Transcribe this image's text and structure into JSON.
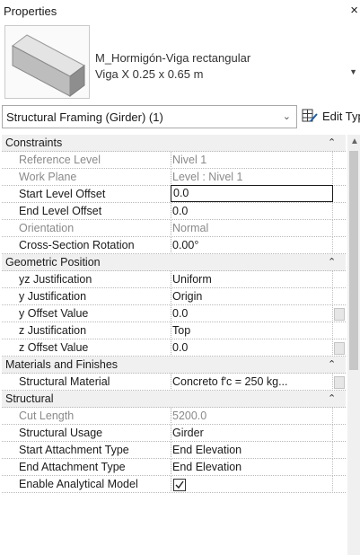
{
  "panel": {
    "title": "Properties",
    "close_glyph": "×"
  },
  "type": {
    "family": "M_Hormigón-Viga rectangular",
    "type_name": "Viga X 0.25 x 0.65 m",
    "thumbnail_icon": "concrete-beam-thumbnail-icon",
    "dropdown_glyph": "▼"
  },
  "selector": {
    "label": "Structural Framing (Girder) (1)",
    "chevron": "⌄",
    "edit_type": "Edit Type",
    "edit_type_icon": "edit-type-icon"
  },
  "groups": [
    {
      "title": "Constraints",
      "rows": [
        {
          "name": "Reference Level",
          "value": "Nivel 1",
          "readonly": true
        },
        {
          "name": "Work Plane",
          "value": "Level : Nivel 1",
          "readonly": true
        },
        {
          "name": "Start Level Offset",
          "value": "0.0",
          "editing": true
        },
        {
          "name": "End Level Offset",
          "value": "0.0"
        },
        {
          "name": "Orientation",
          "value": "Normal",
          "readonly": true
        },
        {
          "name": "Cross-Section Rotation",
          "value": "0.00°"
        }
      ]
    },
    {
      "title": "Geometric Position",
      "rows": [
        {
          "name": "yz Justification",
          "value": "Uniform"
        },
        {
          "name": "y Justification",
          "value": "Origin"
        },
        {
          "name": "y Offset Value",
          "value": "0.0"
        },
        {
          "name": "z Justification",
          "value": "Top"
        },
        {
          "name": "z Offset Value",
          "value": "0.0"
        }
      ]
    },
    {
      "title": "Materials and Finishes",
      "rows": [
        {
          "name": "Structural Material",
          "value": "Concreto f'c = 250 kg..."
        }
      ]
    },
    {
      "title": "Structural",
      "rows": [
        {
          "name": "Cut Length",
          "value": "5200.0",
          "readonly": true
        },
        {
          "name": "Structural Usage",
          "value": "Girder"
        },
        {
          "name": "Start Attachment Type",
          "value": "End Elevation"
        },
        {
          "name": "End Attachment Type",
          "value": "End Elevation"
        },
        {
          "name": "Enable Analytical Model",
          "checked": true
        }
      ]
    }
  ],
  "collapse_glyph": "⌃",
  "scroll_up_glyph": "▲",
  "colors": {
    "header_bg": "#f0f0f0",
    "readonly_text": "#8a8a8a",
    "grid_line": "#b9b9b9"
  }
}
